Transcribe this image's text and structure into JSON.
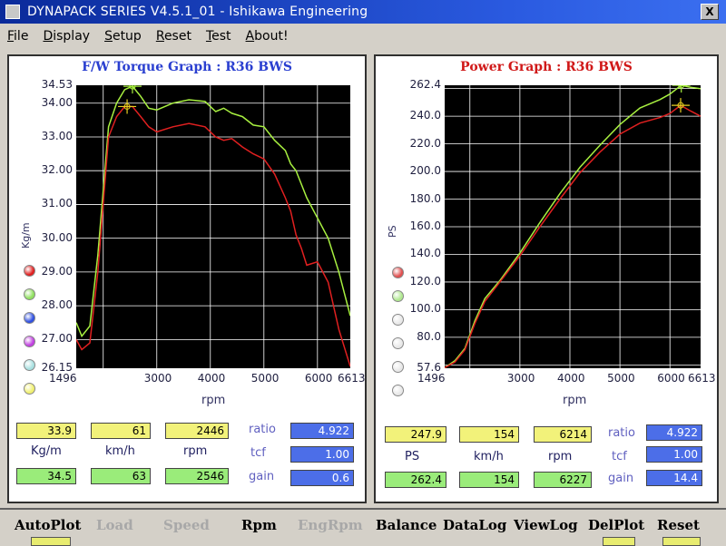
{
  "window": {
    "title": "DYNAPACK SERIES V4.5.1_01  - Ishikawa Engineering",
    "close_glyph": "X"
  },
  "menu": [
    {
      "u": "F",
      "rest": "ile"
    },
    {
      "u": "D",
      "rest": "isplay"
    },
    {
      "u": "S",
      "rest": "etup"
    },
    {
      "u": "R",
      "rest": "eset"
    },
    {
      "u": "T",
      "rest": "est"
    },
    {
      "u": "A",
      "rest": "bout!"
    }
  ],
  "torque": {
    "title": "F/W Torque Graph : R36 BWS",
    "title_color": "#2a3fd0",
    "ylabel": "Kg/m",
    "xlabel": "rpm",
    "yticks": [
      "34.53",
      "34.00",
      "33.00",
      "32.00",
      "31.00",
      "30.00",
      "29.00",
      "28.00",
      "27.00",
      "26.15"
    ],
    "xticks": [
      "1496",
      "3000",
      "4000",
      "5000",
      "6000",
      "6613"
    ],
    "readout_top": {
      "value": "33.9",
      "speed": "61",
      "rpm": "2446",
      "ratio": "4.922"
    },
    "readout_bottom": {
      "value": "34.5",
      "speed": "63",
      "rpm": "2546",
      "gain": "0.6"
    },
    "units": {
      "value": "Kg/m",
      "speed": "km/h",
      "rpm": "rpm"
    },
    "labels": {
      "ratio": "ratio",
      "tcf": "tcf",
      "gain": "gain"
    },
    "tcf": "1.00",
    "dots": [
      "#e02020",
      "#90e060",
      "#3050e0",
      "#c040e0",
      "#a8e0e0",
      "#f0f070"
    ]
  },
  "power": {
    "title": "Power Graph : R36 BWS",
    "title_color": "#d01818",
    "ylabel": "PS",
    "xlabel": "rpm",
    "yticks": [
      "262.4",
      "240.0",
      "220.0",
      "200.0",
      "180.0",
      "160.0",
      "140.0",
      "120.0",
      "100.0",
      "80.0",
      "57.6"
    ],
    "xticks": [
      "1496",
      "3000",
      "4000",
      "5000",
      "6000",
      "6613"
    ],
    "readout_top": {
      "value": "247.9",
      "speed": "154",
      "rpm": "6214",
      "ratio": "4.922"
    },
    "readout_bottom": {
      "value": "262.4",
      "speed": "154",
      "rpm": "6227",
      "gain": "14.4"
    },
    "units": {
      "value": "PS",
      "speed": "km/h",
      "rpm": "rpm"
    },
    "labels": {
      "ratio": "ratio",
      "tcf": "tcf",
      "gain": "gain"
    },
    "tcf": "1.00",
    "dots": [
      "#e05050",
      "#b0e890",
      "#e8e8e8",
      "#e8e8e8",
      "#e8e8e8",
      "#e8e8e8"
    ]
  },
  "chart_data": [
    {
      "type": "line",
      "title": "F/W Torque Graph : R36 BWS",
      "xlabel": "rpm",
      "ylabel": "Kg/m",
      "xlim": [
        1496,
        6613
      ],
      "ylim": [
        26.15,
        34.53
      ],
      "grid": true,
      "series": [
        {
          "color": "#a8f040",
          "x": [
            1496,
            1600,
            1750,
            1900,
            2100,
            2250,
            2400,
            2546,
            2700,
            2850,
            3000,
            3300,
            3600,
            3900,
            4100,
            4250,
            4400,
            4600,
            4800,
            5000,
            5200,
            5400,
            5500,
            5600,
            5700,
            5800,
            6000,
            6200,
            6400,
            6613
          ],
          "y": [
            27.5,
            27.1,
            27.4,
            29.5,
            33.3,
            34.0,
            34.4,
            34.5,
            34.2,
            33.85,
            33.8,
            34.0,
            34.1,
            34.05,
            33.75,
            33.85,
            33.7,
            33.6,
            33.35,
            33.3,
            32.9,
            32.6,
            32.2,
            32.0,
            31.6,
            31.2,
            30.6,
            30.0,
            29.0,
            27.7
          ]
        },
        {
          "color": "#e02020",
          "x": [
            1496,
            1600,
            1750,
            1900,
            2100,
            2250,
            2400,
            2546,
            2700,
            2850,
            3000,
            3300,
            3600,
            3900,
            4100,
            4250,
            4400,
            4600,
            4800,
            5000,
            5200,
            5400,
            5500,
            5600,
            5700,
            5800,
            6000,
            6200,
            6400,
            6613
          ],
          "y": [
            27.0,
            26.7,
            26.9,
            29.0,
            33.0,
            33.6,
            33.9,
            33.9,
            33.6,
            33.3,
            33.15,
            33.3,
            33.4,
            33.3,
            33.0,
            32.9,
            32.95,
            32.7,
            32.5,
            32.35,
            31.9,
            31.2,
            30.8,
            30.1,
            29.7,
            29.2,
            29.3,
            28.7,
            27.3,
            26.2
          ]
        }
      ]
    },
    {
      "type": "line",
      "title": "Power Graph : R36 BWS",
      "xlabel": "rpm",
      "ylabel": "PS",
      "xlim": [
        1496,
        6613
      ],
      "ylim": [
        57.6,
        262.4
      ],
      "grid": true,
      "series": [
        {
          "color": "#a8f040",
          "x": [
            1496,
            1700,
            1900,
            2100,
            2300,
            2600,
            3000,
            3400,
            3800,
            4200,
            4600,
            5000,
            5400,
            5800,
            6000,
            6227,
            6400,
            6613
          ],
          "y": [
            58,
            63,
            72,
            92,
            108,
            121,
            141,
            163,
            184,
            203,
            219,
            234,
            246,
            252,
            256,
            262.4,
            261,
            260
          ]
        },
        {
          "color": "#e02020",
          "x": [
            1496,
            1700,
            1900,
            2100,
            2300,
            2600,
            3000,
            3400,
            3800,
            4200,
            4600,
            5000,
            5400,
            5800,
            6000,
            6214,
            6400,
            6613
          ],
          "y": [
            58,
            62,
            71,
            90,
            106,
            120,
            139,
            160,
            180,
            199,
            214,
            227,
            235,
            239,
            242,
            247.9,
            244,
            240
          ]
        }
      ]
    }
  ],
  "toolbar": [
    {
      "label": "AutoPlot",
      "enabled": true
    },
    {
      "label": "Load",
      "enabled": false
    },
    {
      "label": "Speed",
      "enabled": false
    },
    {
      "label": "Rpm",
      "enabled": true
    },
    {
      "label": "EngRpm",
      "enabled": false
    },
    {
      "label": "Balance",
      "enabled": true
    },
    {
      "label": "DataLog",
      "enabled": true
    },
    {
      "label": "ViewLog",
      "enabled": true
    },
    {
      "label": "DelPlot",
      "enabled": true
    },
    {
      "label": "Reset",
      "enabled": true
    }
  ]
}
